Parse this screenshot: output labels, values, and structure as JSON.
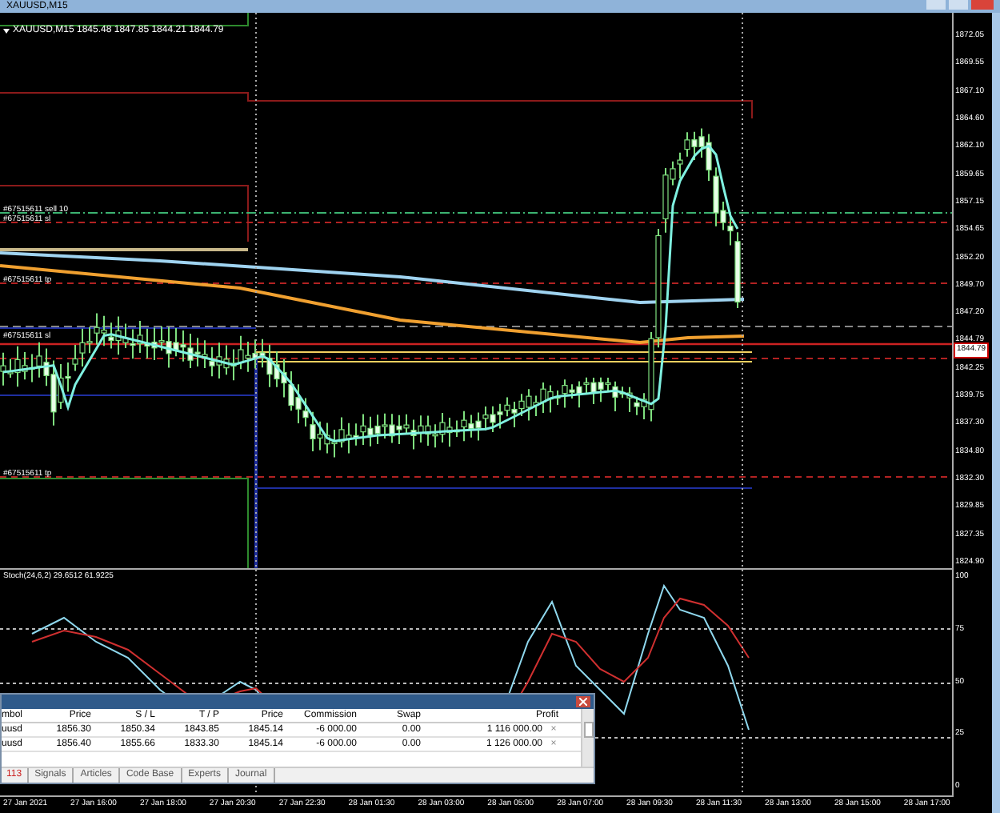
{
  "window": {
    "title": "XAUUSD,M15"
  },
  "chart": {
    "header": "XAUUSD,M15  1845.48 1847.85 1844.21 1844.79",
    "trade_labels": [
      "#67515611 sell 10",
      "#67515611 sl",
      "#67515611 tp",
      "#67515611 sl",
      "#67515611 tp"
    ],
    "price_axis": [
      "1872.05",
      "1869.55",
      "1867.10",
      "1864.60",
      "1862.10",
      "1859.65",
      "1857.15",
      "1854.65",
      "1852.20",
      "1849.70",
      "1847.20",
      "1844.79",
      "1842.25",
      "1839.75",
      "1837.30",
      "1834.80",
      "1832.30",
      "1829.85",
      "1827.35",
      "1824.90"
    ],
    "current_price": "1844.79"
  },
  "indicator": {
    "header": "Stoch(24,6,2) 29.6512 61.9225",
    "axis": [
      "100",
      "75",
      "50",
      "25",
      "0"
    ]
  },
  "time_axis": [
    "27 Jan 2021",
    "27 Jan 16:00",
    "27 Jan 18:00",
    "27 Jan 20:30",
    "27 Jan 22:30",
    "28 Jan 01:30",
    "28 Jan 03:00",
    "28 Jan 05:00",
    "28 Jan 07:00",
    "28 Jan 09:30",
    "28 Jan 11:30",
    "28 Jan 13:00",
    "28 Jan 15:00",
    "28 Jan 17:00"
  ],
  "terminal": {
    "columns": [
      "mbol",
      "Price",
      "S / L",
      "T / P",
      "Price",
      "Commission",
      "Swap",
      "Profit"
    ],
    "rows": [
      {
        "cells": [
          "uusd",
          "1856.30",
          "1850.34",
          "1843.85",
          "1845.14",
          "-6 000.00",
          "0.00",
          "1 116 000.00"
        ],
        "close": "×"
      },
      {
        "cells": [
          "uusd",
          "1856.40",
          "1855.66",
          "1833.30",
          "1845.14",
          "-6 000.00",
          "0.00",
          "1 126 000.00"
        ],
        "close": "×"
      }
    ],
    "tabs": [
      {
        "label": "113",
        "kind": "count"
      },
      {
        "label": "Signals",
        "kind": "tab"
      },
      {
        "label": "Articles",
        "kind": "tab"
      },
      {
        "label": "Code Base",
        "kind": "tab"
      },
      {
        "label": "Experts",
        "kind": "tab"
      },
      {
        "label": "Journal",
        "kind": "tab"
      }
    ]
  }
}
